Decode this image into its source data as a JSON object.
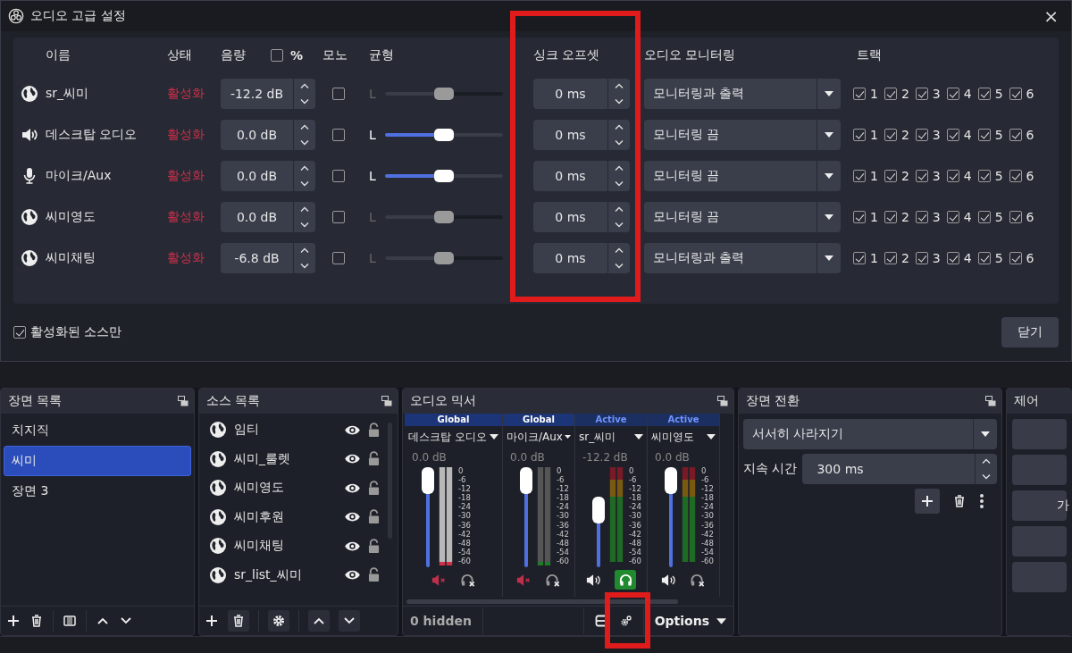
{
  "dialog": {
    "title": "오디오 고급 설정",
    "close": "×",
    "columns": {
      "name": "이름",
      "status": "상태",
      "volume": "음량",
      "percent": {
        "label": "%",
        "checked": false
      },
      "mono": "모노",
      "balance": "균형",
      "sync": "싱크 오프셋",
      "monitoring": "오디오 모니터링",
      "tracks": "트랙"
    },
    "rows": [
      {
        "kind": "browser",
        "name": "sr_씨미",
        "status": "활성화",
        "volume": "-12.2 dB",
        "mono": false,
        "balance_label": "L",
        "balance_disabled": true,
        "level": 0.5,
        "sync": "0 ms",
        "monitoring": "모니터링과 출력",
        "tracks": [
          {
            "label": "1",
            "checked": true
          },
          {
            "label": "2",
            "checked": true
          },
          {
            "label": "3",
            "checked": true
          },
          {
            "label": "4",
            "checked": true
          },
          {
            "label": "5",
            "checked": true
          },
          {
            "label": "6",
            "checked": true
          }
        ]
      },
      {
        "kind": "speaker",
        "name": "데스크탑 오디오",
        "status": "활성화",
        "volume": "0.0 dB",
        "mono": false,
        "balance_label": "L",
        "balance_disabled": false,
        "level": 0.5,
        "sync": "0 ms",
        "monitoring": "모니터링 끔",
        "tracks": [
          {
            "label": "1",
            "checked": true
          },
          {
            "label": "2",
            "checked": true
          },
          {
            "label": "3",
            "checked": true
          },
          {
            "label": "4",
            "checked": true
          },
          {
            "label": "5",
            "checked": true
          },
          {
            "label": "6",
            "checked": true
          }
        ]
      },
      {
        "kind": "mic",
        "name": "마이크/Aux",
        "status": "활성화",
        "volume": "0.0 dB",
        "mono": false,
        "balance_label": "L",
        "balance_disabled": false,
        "level": 0.5,
        "sync": "0 ms",
        "monitoring": "모니터링 끔",
        "tracks": [
          {
            "label": "1",
            "checked": true
          },
          {
            "label": "2",
            "checked": true
          },
          {
            "label": "3",
            "checked": true
          },
          {
            "label": "4",
            "checked": true
          },
          {
            "label": "5",
            "checked": true
          },
          {
            "label": "6",
            "checked": true
          }
        ]
      },
      {
        "kind": "browser",
        "name": "씨미영도",
        "status": "활성화",
        "volume": "0.0 dB",
        "mono": false,
        "balance_label": "L",
        "balance_disabled": true,
        "level": 0.5,
        "sync": "0 ms",
        "monitoring": "모니터링 끔",
        "tracks": [
          {
            "label": "1",
            "checked": true
          },
          {
            "label": "2",
            "checked": true
          },
          {
            "label": "3",
            "checked": true
          },
          {
            "label": "4",
            "checked": true
          },
          {
            "label": "5",
            "checked": true
          },
          {
            "label": "6",
            "checked": true
          }
        ]
      },
      {
        "kind": "browser",
        "name": "씨미채팅",
        "status": "활성화",
        "volume": "-6.8 dB",
        "mono": false,
        "balance_label": "L",
        "balance_disabled": true,
        "level": 0.5,
        "sync": "0 ms",
        "monitoring": "모니터링과 출력",
        "tracks": [
          {
            "label": "1",
            "checked": true
          },
          {
            "label": "2",
            "checked": true
          },
          {
            "label": "3",
            "checked": true
          },
          {
            "label": "4",
            "checked": true
          },
          {
            "label": "5",
            "checked": true
          },
          {
            "label": "6",
            "checked": true
          }
        ]
      }
    ],
    "active_only": {
      "label": "활성화된 소스만",
      "checked": true
    },
    "close_button": "닫기"
  },
  "scenes": {
    "title": "장면 목록",
    "items": [
      {
        "label": "치지직",
        "selected": false
      },
      {
        "label": "씨미",
        "selected": true
      },
      {
        "label": "장면 3",
        "selected": false
      }
    ]
  },
  "sources": {
    "title": "소스 목록",
    "items": [
      {
        "label": "임티",
        "visible": true,
        "locked": false
      },
      {
        "label": "씨미_룰렛",
        "visible": true,
        "locked": false
      },
      {
        "label": "씨미영도",
        "visible": true,
        "locked": false
      },
      {
        "label": "씨미후원",
        "visible": true,
        "locked": false
      },
      {
        "label": "씨미채팅",
        "visible": true,
        "locked": false
      },
      {
        "label": "sr_list_씨미",
        "visible": true,
        "locked": false
      }
    ]
  },
  "mixer": {
    "title": "오디오 믹서",
    "hidden": "0 hidden",
    "options": "Options",
    "channels": [
      {
        "kind": "global",
        "header": "Global",
        "name": "데스크탑 오디오",
        "db": "0.0 dB",
        "level": 1,
        "muted": true,
        "monitoring": false,
        "scale": [
          "0",
          "-6",
          "-12",
          "-18",
          "-24",
          "-30",
          "-36",
          "-42",
          "-48",
          "-54",
          "-60"
        ]
      },
      {
        "kind": "global",
        "header": "Global",
        "name": "마이크/Aux",
        "db": "0.0 dB",
        "level": 1,
        "muted": true,
        "monitoring": false,
        "scale": [
          "0",
          "-6",
          "-12",
          "-18",
          "-24",
          "-30",
          "-36",
          "-42",
          "-48",
          "-54",
          "-60"
        ]
      },
      {
        "kind": "active",
        "header": "Active",
        "name": "sr_씨미",
        "db": "-12.2 dB",
        "level": 0.6,
        "muted": false,
        "monitoring": true,
        "scale": [
          "0",
          "-6",
          "-12",
          "-18",
          "-24",
          "-30",
          "-36",
          "-42",
          "-48",
          "-54",
          "-60"
        ]
      },
      {
        "kind": "active",
        "header": "Active",
        "name": "씨미영도",
        "db": "0.0 dB",
        "level": 1,
        "muted": false,
        "monitoring": false,
        "scale": [
          "0",
          "-6",
          "-12",
          "-18",
          "-24",
          "-30",
          "-36",
          "-42",
          "-48",
          "-54",
          "-60"
        ]
      }
    ]
  },
  "transition": {
    "title": "장면 전환",
    "type": "서서히 사라지기",
    "duration_label": "지속 시간",
    "duration": "300 ms"
  },
  "controls": {
    "title": "제어",
    "button_label": "가"
  }
}
